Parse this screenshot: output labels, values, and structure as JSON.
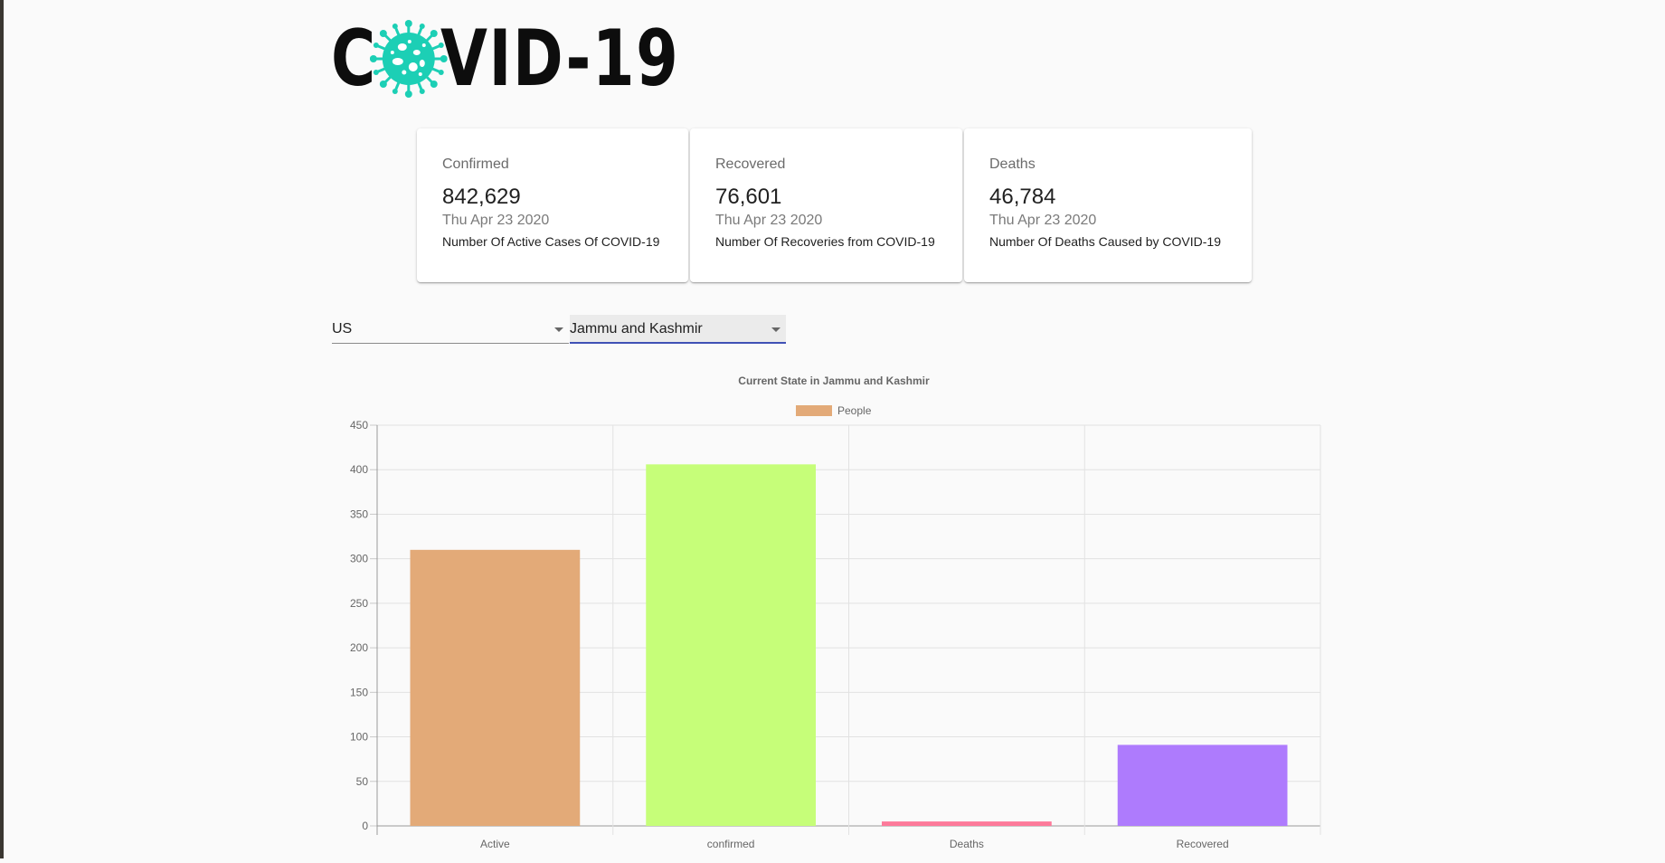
{
  "header": {
    "logo_text_left": "C",
    "logo_text_right": "VID-19"
  },
  "cards": [
    {
      "title": "Confirmed",
      "value": "842,629",
      "date": "Thu Apr 23 2020",
      "description": "Number Of Active Cases Of COVID-19"
    },
    {
      "title": "Recovered",
      "value": "76,601",
      "date": "Thu Apr 23 2020",
      "description": "Number Of Recoveries from COVID-19"
    },
    {
      "title": "Deaths",
      "value": "46,784",
      "date": "Thu Apr 23 2020",
      "description": "Number Of Deaths Caused by COVID-19"
    }
  ],
  "selectors": {
    "country": "US",
    "state": "Jammu and Kashmir"
  },
  "colors": {
    "logo_virus": "#1ccfb5",
    "select_underline_active": "#3f51b5"
  },
  "chart_data": {
    "type": "bar",
    "title": "Current State in Jammu and Kashmir",
    "legend": "People",
    "legend_position": "top",
    "categories": [
      "Active",
      "confirmed",
      "Deaths",
      "Recovered"
    ],
    "values": [
      310,
      406,
      5,
      91
    ],
    "bar_colors": [
      "#e3aa78",
      "#c6fe79",
      "#fd7a9a",
      "#ae7bfd"
    ],
    "legend_color": "#e3aa78",
    "ylim": [
      0,
      450
    ],
    "yticks": [
      0,
      50,
      100,
      150,
      200,
      250,
      300,
      350,
      400,
      450
    ],
    "grid": true
  }
}
